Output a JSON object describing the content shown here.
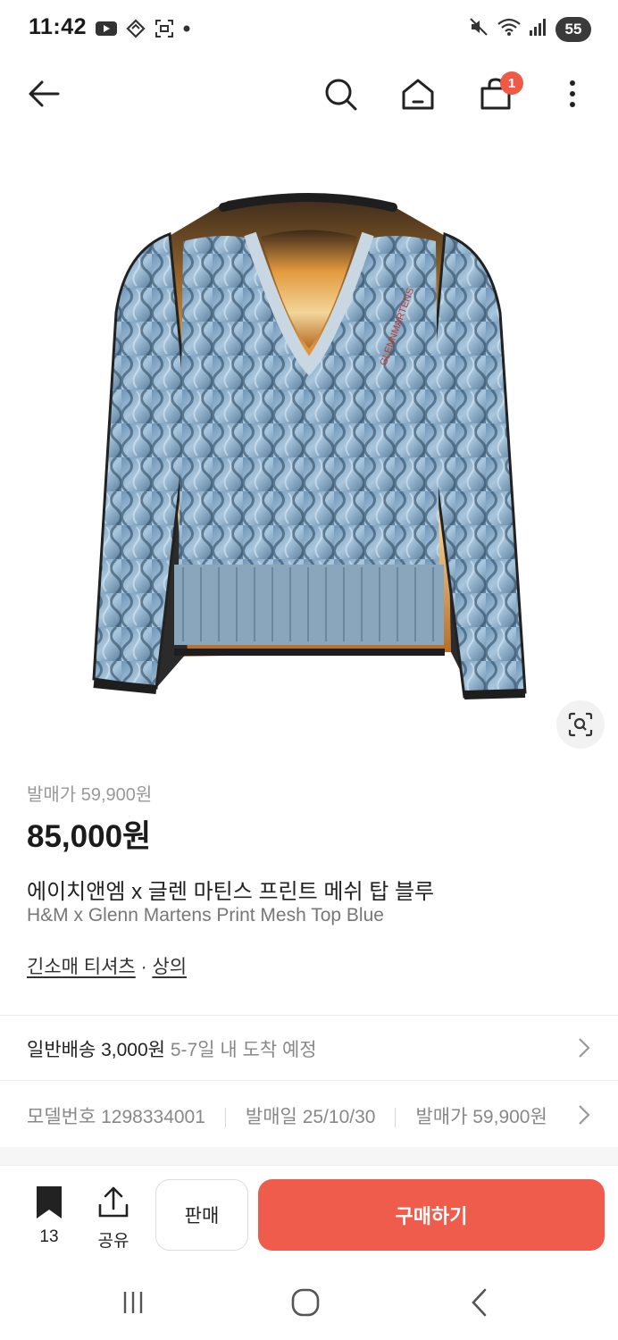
{
  "status_bar": {
    "time": "11:42",
    "battery": "55",
    "left_icons": [
      "youtube-icon",
      "sync-icon",
      "screenshot-icon",
      "dot-icon"
    ],
    "right_icons": [
      "mute-icon",
      "wifi-icon",
      "signal-icon"
    ]
  },
  "app_bar": {
    "cart_badge": "1",
    "icons": [
      "back-icon",
      "search-icon",
      "home-icon",
      "cart-icon",
      "more-icon"
    ]
  },
  "product": {
    "release_price_text": "발매가 59,900원",
    "price": "85,000원",
    "title_ko": "에이치앤엠 x 글렌 마틴스 프린트 메쉬 탑 블루",
    "title_en": "H&M x Glenn Martens Print Mesh Top Blue",
    "category_1": "긴소매 티셔츠",
    "category_sep": " · ",
    "category_2": "상의"
  },
  "shipping": {
    "label": "일반배송 3,000원",
    "eta": "5-7일 내 도착 예정"
  },
  "meta": {
    "model_no": "모델번호 1298334001",
    "release_date": "발매일 25/10/30",
    "release_price": "발매가 59,900원"
  },
  "bottom_bar": {
    "bookmark_count": "13",
    "share_label": "공유",
    "sell_label": "판매",
    "buy_label": "구매하기"
  },
  "colors": {
    "accent": "#ef5c4b",
    "badge": "#ef5a47",
    "muted_text": "#888888"
  }
}
